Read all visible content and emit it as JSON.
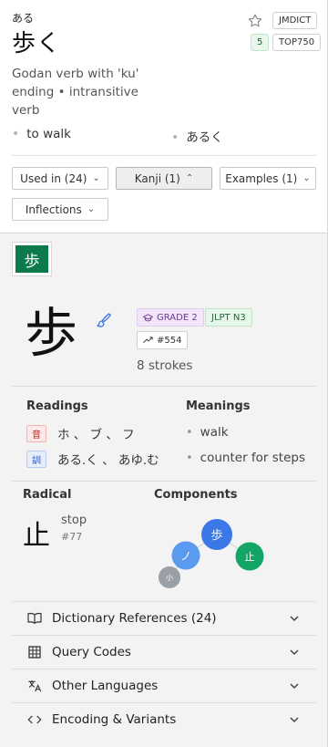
{
  "entry": {
    "furigana": "ある",
    "word": "歩く",
    "badges": {
      "source": "JMDICT",
      "frequency_tag": "TOP750",
      "level": "5"
    },
    "part_of_speech": "Godan verb with 'ku' ending • intransitive verb",
    "meanings": [
      "to walk",
      "あるく"
    ]
  },
  "tabs": [
    {
      "label": "Used in (24)",
      "active": false
    },
    {
      "label": "Kanji (1)",
      "active": true
    },
    {
      "label": "Examples (1)",
      "active": false
    },
    {
      "label": "Inflections",
      "active": false
    }
  ],
  "kanji": {
    "tab_label": "歩",
    "character": "歩",
    "grade_label": "GRADE 2",
    "jlpt_label": "JLPT N3",
    "rank_label": "#554",
    "strokes": "8 strokes",
    "readings_heading": "Readings",
    "meanings_heading": "Meanings",
    "on_tag": "音",
    "on_reading": "ホ 、 ブ 、 フ",
    "kun_tag": "訓",
    "kun_reading": "ある.く 、 あゆ.む",
    "meanings": [
      "walk",
      "counter for steps"
    ],
    "radical_heading": "Radical",
    "components_heading": "Components",
    "radical": {
      "char": "止",
      "name": "stop",
      "number": "#77"
    },
    "components": [
      {
        "char": "歩",
        "color": "#3b78e7"
      },
      {
        "char": "ノ",
        "color": "#5b9bef"
      },
      {
        "char": "止",
        "color": "#12a566"
      },
      {
        "char": "小",
        "color": "#9aa0a6"
      }
    ]
  },
  "sections": [
    {
      "label": "Dictionary References (24)",
      "icon": "book-icon"
    },
    {
      "label": "Query Codes",
      "icon": "grid-icon"
    },
    {
      "label": "Other Languages",
      "icon": "translate-icon"
    },
    {
      "label": "Encoding & Variants",
      "icon": "code-icon"
    }
  ],
  "colors": {
    "accent_green": "#0b7a4c",
    "grade_purple": "#6a3a8e",
    "jlpt_green": "#1d6b37"
  }
}
